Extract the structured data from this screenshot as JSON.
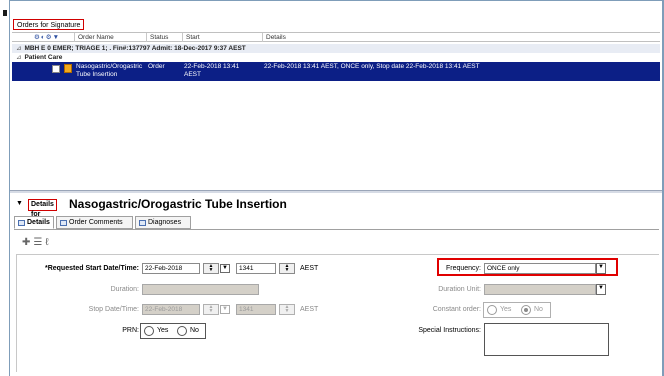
{
  "orders_panel": {
    "title": "Orders for Signature",
    "columns": [
      "Order Name",
      "Status",
      "Start",
      "Details"
    ],
    "encounter": "MBH E 0 EMER; TRIAGE 1; . Fin#:137797  Admit: 18-Dec-2017 9:37 AEST",
    "group": "Patient Care",
    "order": {
      "name_line1": "Nasogastric/Orogastric",
      "name_line2": "Tube Insertion",
      "status": "Order",
      "start_line1": "22-Feb-2018 13:41",
      "start_line2": "AEST",
      "details": "22-Feb-2018 13:41 AEST, ONCE only, Stop date 22-Feb-2018 13:41 AEST"
    }
  },
  "details": {
    "label_small": "Details for",
    "title": "Nasogastric/Orogastric Tube Insertion",
    "tabs": [
      "Details",
      "Order Comments",
      "Diagnoses"
    ],
    "form": {
      "start_label": "*Requested Start Date/Time:",
      "start_date": "22-Feb-2018",
      "start_time": "1341",
      "start_tz": "AEST",
      "duration_label": "Duration:",
      "stop_label": "Stop Date/Time:",
      "stop_date": "22-Feb-2018",
      "stop_time": "1341",
      "stop_tz": "AEST",
      "prn_label": "PRN:",
      "prn_yes": "Yes",
      "prn_no": "No",
      "frequency_label": "Frequency:",
      "frequency_value": "ONCE only",
      "duration_unit_label": "Duration Unit:",
      "constant_label": "Constant order:",
      "constant_yes": "Yes",
      "constant_no": "No",
      "special_label": "Special Instructions:"
    }
  },
  "colors": {
    "selection": "#0c1f86",
    "highlight_box": "#e00000",
    "disabled_field": "#d4d0c8"
  }
}
